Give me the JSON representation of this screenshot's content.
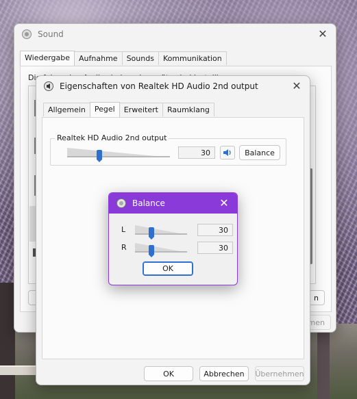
{
  "sound_window": {
    "title": "Sound",
    "tabs": [
      {
        "label": "Wiedergabe",
        "active": true
      },
      {
        "label": "Aufnahme",
        "active": false
      },
      {
        "label": "Sounds",
        "active": false
      },
      {
        "label": "Kommunikation",
        "active": false
      }
    ],
    "intro_text": "Die folgenden Audiowiedergabegeräte sind installiert:",
    "left_button_partial": "K",
    "right_button_partial": "n",
    "bottom_button_partial": "nehmen"
  },
  "properties_window": {
    "title": "Eigenschaften von Realtek HD Audio 2nd output",
    "tabs": [
      {
        "label": "Allgemein",
        "active": false
      },
      {
        "label": "Pegel",
        "active": true
      },
      {
        "label": "Erweitert",
        "active": false
      },
      {
        "label": "Raumklang",
        "active": false
      }
    ],
    "group_label": "Realtek HD Audio 2nd output",
    "level_value": "30",
    "level_fraction": 0.3,
    "balance_button": "Balance",
    "ok_button": "OK",
    "cancel_button": "Abbrechen",
    "apply_button": "Übernehmen",
    "speaker_icon": "speaker-icon"
  },
  "balance_window": {
    "title": "Balance",
    "channels": [
      {
        "label": "L",
        "value": "30",
        "fraction": 0.3
      },
      {
        "label": "R",
        "value": "30",
        "fraction": 0.3
      }
    ],
    "ok_button": "OK"
  },
  "colors": {
    "accent_blue": "#2f6fd0",
    "balance_titlebar": "#8a3ad8"
  }
}
